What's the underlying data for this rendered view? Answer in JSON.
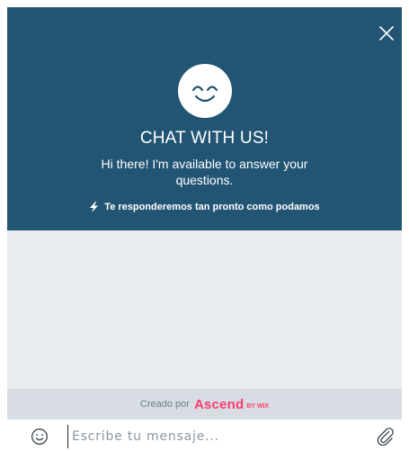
{
  "header": {
    "title": "CHAT WITH US!",
    "subtitle": "Hi there! I'm available to answer your questions.",
    "response_time": "Te responderemos tan pronto como podamos",
    "close_icon": "close-icon",
    "avatar_icon": "smiley-face-icon",
    "bolt_icon": "lightning-bolt-icon"
  },
  "footer": {
    "prefix": "Creado por",
    "brand": "Ascend",
    "brand_suffix": "BY WIX"
  },
  "composer": {
    "placeholder": "Escribe tu mensaje...",
    "emoji_icon": "emoji-icon",
    "attach_icon": "paperclip-icon"
  },
  "colors": {
    "header_bg": "#225573",
    "body_bg": "#e9edf0",
    "footer_bg": "#d7dde3",
    "brand": "#ff3d6e"
  }
}
